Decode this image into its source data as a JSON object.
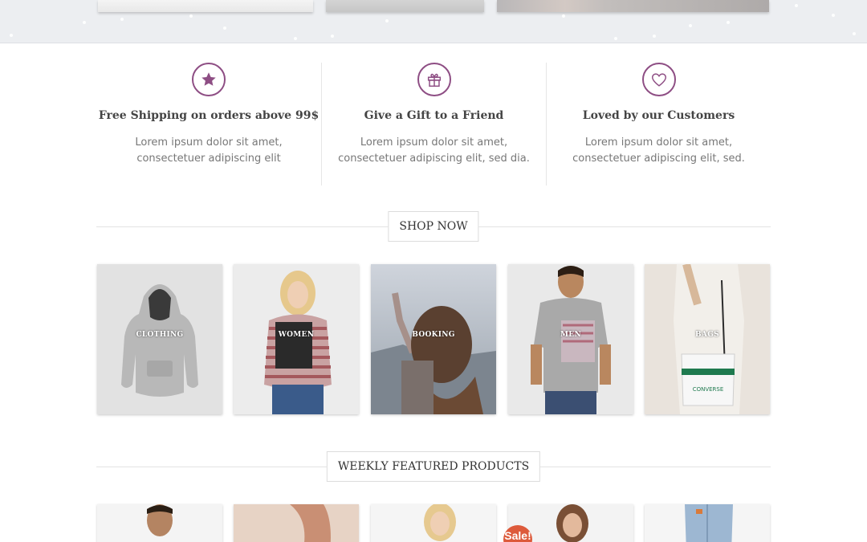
{
  "features": [
    {
      "icon": "star-icon",
      "title": "Free Shipping on orders above 99$",
      "text": "Lorem ipsum dolor sit amet, consectetuer adipiscing elit"
    },
    {
      "icon": "gift-icon",
      "title": "Give a Gift to a Friend",
      "text": "Lorem ipsum dolor sit amet, consectetuer adipiscing elit, sed dia."
    },
    {
      "icon": "heart-icon",
      "title": "Loved by our Customers",
      "text": "Lorem ipsum dolor sit amet, consectetuer adipiscing elit, sed."
    }
  ],
  "shop_now": {
    "label": "SHOP NOW"
  },
  "categories": [
    {
      "label": "CLOTHING"
    },
    {
      "label": "WOMEN"
    },
    {
      "label": "BOOKING"
    },
    {
      "label": "MEN"
    },
    {
      "label": "BAGS"
    }
  ],
  "weekly": {
    "label": "WEEKLY FEATURED PRODUCTS",
    "sale_badge": "Sale!"
  },
  "colors": {
    "accent": "#8e4e84",
    "sale": "#dd5a3b"
  }
}
